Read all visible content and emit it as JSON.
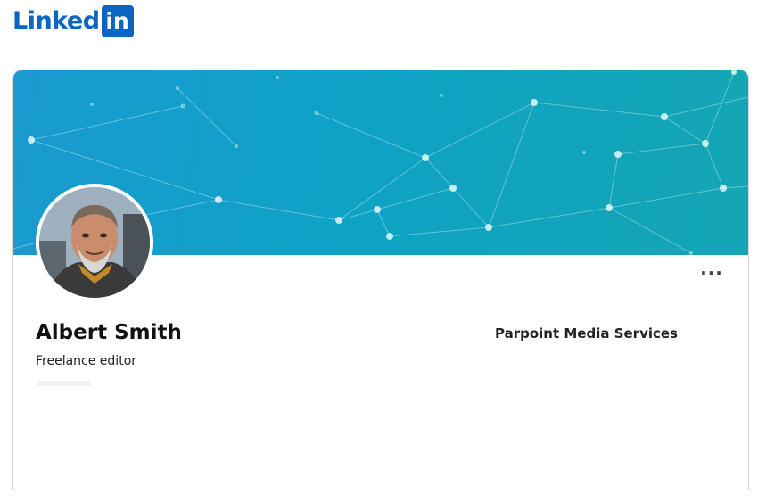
{
  "brand": {
    "wordmark": "Linked",
    "box_text": "in",
    "color": "#0a66c2"
  },
  "profile": {
    "name": "Albert Smith",
    "headline": "Freelance editor",
    "company": "Parpoint Media Services",
    "more_icon": "ellipsis-icon",
    "more_label": "···"
  },
  "colors": {
    "banner_start": "#1a9ad0",
    "banner_end": "#14a6b3",
    "network": "#ffffff"
  }
}
